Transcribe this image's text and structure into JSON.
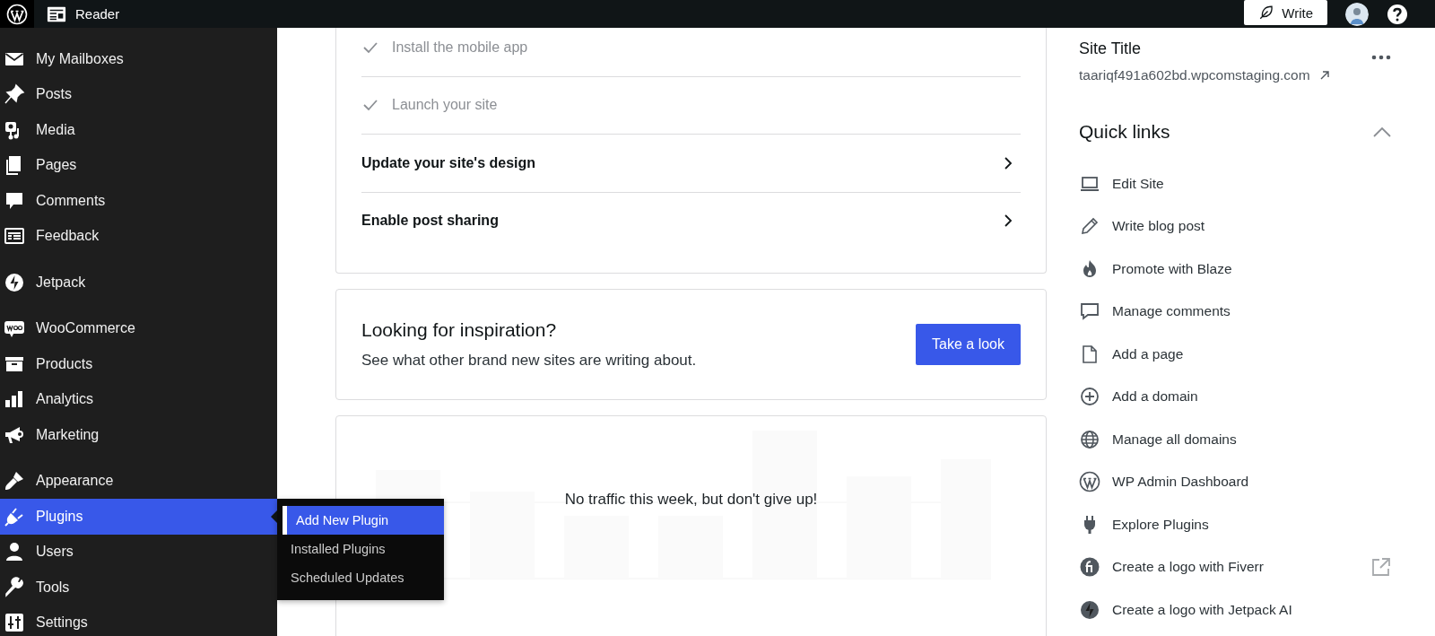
{
  "top_bar": {
    "reader_label": "Reader",
    "write_button": "Write"
  },
  "sidebar": {
    "sections": [
      {
        "items": [
          {
            "label": "My Mailboxes",
            "selected": false
          },
          {
            "label": "Posts",
            "selected": false
          },
          {
            "label": "Media",
            "selected": false
          },
          {
            "label": "Pages",
            "selected": false
          },
          {
            "label": "Comments",
            "selected": false
          },
          {
            "label": "Feedback",
            "selected": false
          }
        ]
      },
      {
        "items": [
          {
            "label": "Jetpack",
            "selected": false
          }
        ]
      },
      {
        "items": [
          {
            "label": "WooCommerce",
            "selected": false
          },
          {
            "label": "Products",
            "selected": false
          },
          {
            "label": "Analytics",
            "selected": false
          },
          {
            "label": "Marketing",
            "selected": false
          }
        ]
      },
      {
        "items": [
          {
            "label": "Appearance",
            "selected": false
          },
          {
            "label": "Plugins",
            "selected": true,
            "submenu": [
              {
                "label": "Add New Plugin",
                "selected": true
              },
              {
                "label": "Installed Plugins",
                "selected": false
              },
              {
                "label": "Scheduled Updates",
                "selected": false
              }
            ]
          },
          {
            "label": "Users",
            "selected": false
          },
          {
            "label": "Tools",
            "selected": false
          },
          {
            "label": "Settings",
            "selected": false
          }
        ]
      }
    ]
  },
  "checklist": [
    {
      "label": "Install the mobile app",
      "done": true
    },
    {
      "label": "Launch your site",
      "done": true
    },
    {
      "label": "Update your site's design",
      "done": false
    },
    {
      "label": "Enable post sharing",
      "done": false
    }
  ],
  "inspiration": {
    "title": "Looking for inspiration?",
    "text": "See what other brand new sites are writing about.",
    "button": "Take a look"
  },
  "traffic": {
    "message": "No traffic this week, but don't give up!"
  },
  "site": {
    "title": "Site Title",
    "url": "taariqf491a602bd.wpcomstaging.com"
  },
  "quick_links": {
    "title": "Quick links",
    "expanded": true,
    "items": [
      {
        "label": "Edit Site",
        "external": false
      },
      {
        "label": "Write blog post",
        "external": false
      },
      {
        "label": "Promote with Blaze",
        "external": false
      },
      {
        "label": "Manage comments",
        "external": false
      },
      {
        "label": "Add a page",
        "external": false
      },
      {
        "label": "Add a domain",
        "external": false
      },
      {
        "label": "Manage all domains",
        "external": false
      },
      {
        "label": "WP Admin Dashboard",
        "external": false
      },
      {
        "label": "Explore Plugins",
        "external": false
      },
      {
        "label": "Create a logo with Fiverr",
        "external": true
      },
      {
        "label": "Create a logo with Jetpack AI",
        "external": false
      }
    ]
  }
}
